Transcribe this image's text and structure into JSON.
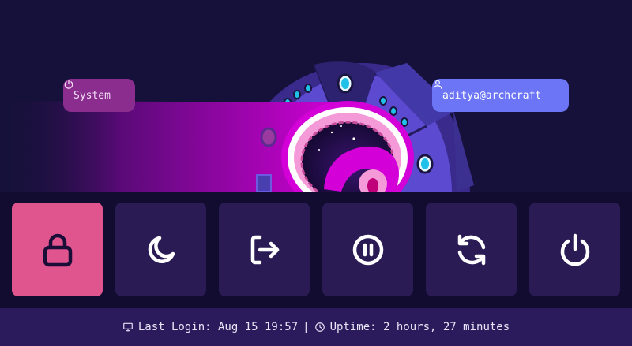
{
  "header": {
    "system_label": "System",
    "user_label": "aditya@archcraft"
  },
  "actions": [
    {
      "name": "lock",
      "icon": "lock-icon",
      "active": true
    },
    {
      "name": "suspend",
      "icon": "moon-icon",
      "active": false
    },
    {
      "name": "logout",
      "icon": "logout-icon",
      "active": false
    },
    {
      "name": "hibernate",
      "icon": "pause-icon",
      "active": false
    },
    {
      "name": "reboot",
      "icon": "refresh-icon",
      "active": false
    },
    {
      "name": "shutdown",
      "icon": "power-icon",
      "active": false
    }
  ],
  "footer": {
    "last_login_label": "Last Login: Aug 15 19:57",
    "separator": "|",
    "uptime_label": "Uptime: 2 hours, 27 minutes"
  },
  "colors": {
    "background": "#16113a",
    "button_bg": "#2a1b55",
    "active_button": "#e0558e",
    "system_pill": "#8a2d8f",
    "user_pill": "#6c75f6",
    "footer_bg": "#2c1b5c"
  }
}
